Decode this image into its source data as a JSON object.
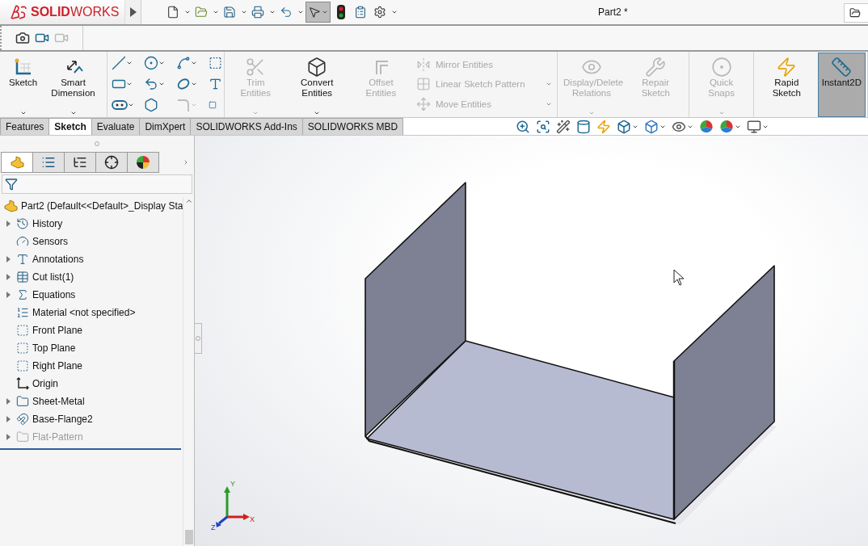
{
  "app": {
    "logo": "**SOLID**WORKS",
    "title": "Part2 *"
  },
  "ribbon": [
    [
      {
        "kind": "large",
        "label": "Sketch",
        "disabled": false,
        "pressed": false,
        "dropdown": true
      },
      {
        "kind": "large",
        "label": "Smart Dimension",
        "disabled": false,
        "pressed": false,
        "dropdown": true
      }
    ],
    [
      {
        "kind": "grid"
      }
    ],
    [
      {
        "kind": "large",
        "label": "Trim Entities",
        "disabled": true,
        "pressed": false,
        "dropdown": true
      },
      {
        "kind": "large",
        "label": "Convert Entities",
        "disabled": false,
        "pressed": false,
        "dropdown": true
      },
      {
        "kind": "large",
        "label": "Offset Entities",
        "disabled": true,
        "pressed": false,
        "dropdown": false
      },
      {
        "kind": "stack",
        "entries": [
          {
            "label": "Mirror Entities",
            "disabled": true,
            "dropdown": false
          },
          {
            "label": "Linear Sketch Pattern",
            "disabled": true,
            "dropdown": true
          },
          {
            "label": "Move Entities",
            "disabled": true,
            "dropdown": true
          }
        ]
      }
    ],
    [
      {
        "kind": "large",
        "label": "Display/Delete Relations",
        "disabled": true,
        "pressed": false,
        "dropdown": true
      },
      {
        "kind": "large",
        "label": "Repair Sketch",
        "disabled": true,
        "pressed": false,
        "dropdown": false
      }
    ],
    [
      {
        "kind": "large",
        "label": "Quick Snaps",
        "disabled": true,
        "pressed": false,
        "dropdown": true
      }
    ],
    [
      {
        "kind": "large",
        "label": "Rapid Sketch",
        "disabled": false,
        "pressed": false,
        "dropdown": false
      },
      {
        "kind": "large",
        "label": "Instant2D",
        "disabled": false,
        "pressed": true,
        "dropdown": false
      }
    ]
  ],
  "tabs": [
    {
      "label": "Features",
      "selected": false
    },
    {
      "label": "Sketch",
      "selected": true
    },
    {
      "label": "Evaluate",
      "selected": false
    },
    {
      "label": "DimXpert",
      "selected": false
    },
    {
      "label": "SOLIDWORKS Add-Ins",
      "selected": false
    },
    {
      "label": "SOLIDWORKS MBD",
      "selected": false
    }
  ],
  "panel_tabs": [
    {
      "selected": true
    },
    {
      "selected": false
    },
    {
      "selected": false
    },
    {
      "selected": false
    },
    {
      "selected": false
    }
  ],
  "tree": {
    "root": "Part2  (Default<<Default>_Display Sta",
    "items": [
      {
        "label": "History",
        "expandable": true,
        "disabled": false
      },
      {
        "label": "Sensors",
        "expandable": false,
        "disabled": false
      },
      {
        "label": "Annotations",
        "expandable": true,
        "disabled": false
      },
      {
        "label": "Cut list(1)",
        "expandable": true,
        "disabled": false
      },
      {
        "label": "Equations",
        "expandable": true,
        "disabled": false
      },
      {
        "label": "Material <not specified>",
        "expandable": false,
        "disabled": false
      },
      {
        "label": "Front Plane",
        "expandable": false,
        "disabled": false
      },
      {
        "label": "Top Plane",
        "expandable": false,
        "disabled": false
      },
      {
        "label": "Right Plane",
        "expandable": false,
        "disabled": false
      },
      {
        "label": "Origin",
        "expandable": false,
        "disabled": false
      },
      {
        "label": "Sheet-Metal",
        "expandable": true,
        "disabled": false
      },
      {
        "label": "Base-Flange2",
        "expandable": true,
        "disabled": false
      },
      {
        "label": "Flat-Pattern",
        "expandable": true,
        "disabled": true
      }
    ]
  },
  "triad": {
    "x": "X",
    "y": "Y",
    "z": "Z"
  }
}
